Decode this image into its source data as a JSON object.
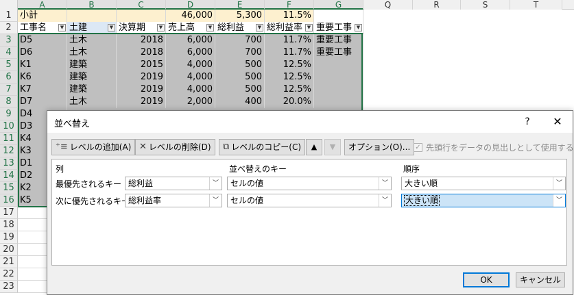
{
  "sheet": {
    "columns": [
      "A",
      "B",
      "C",
      "D",
      "E",
      "F",
      "G",
      "Q",
      "R",
      "S",
      "T"
    ],
    "rows": [
      "1",
      "2",
      "3",
      "4",
      "5",
      "6",
      "7",
      "8",
      "9",
      "10",
      "11",
      "12",
      "13",
      "14",
      "15",
      "16",
      "17",
      "18",
      "19",
      "20",
      "21",
      "22",
      "23"
    ],
    "row1": [
      "小計",
      "",
      "",
      "46,000",
      "5,300",
      "11.5%",
      ""
    ],
    "headers": [
      "工事名",
      "土建",
      "決算期",
      "売上高",
      "総利益",
      "総利益率",
      "重要工事"
    ],
    "data": [
      [
        "D5",
        "土木",
        "2018",
        "6,000",
        "700",
        "11.7%",
        "重要工事"
      ],
      [
        "D6",
        "土木",
        "2018",
        "6,000",
        "700",
        "11.7%",
        "重要工事"
      ],
      [
        "K1",
        "建築",
        "2015",
        "4,000",
        "500",
        "12.5%",
        ""
      ],
      [
        "K6",
        "建築",
        "2019",
        "4,000",
        "500",
        "12.5%",
        ""
      ],
      [
        "K7",
        "建築",
        "2019",
        "4,000",
        "500",
        "12.5%",
        ""
      ],
      [
        "D7",
        "土木",
        "2019",
        "2,000",
        "400",
        "20.0%",
        ""
      ]
    ],
    "partial_col_a": [
      "D4",
      "D3",
      "K4",
      "K3",
      "D1",
      "D2",
      "K2",
      "K5"
    ]
  },
  "dialog": {
    "title": "並べ替え",
    "help": "?",
    "close": "✕",
    "toolbar": {
      "add_label": "レベルの追加(A)",
      "delete_label": "レベルの削除(D)",
      "copy_label": "レベルのコピー(C)",
      "up": "▲",
      "down": "▼",
      "options_label": "オプション(O)...",
      "header_check_label": "先頭行をデータの見出しとして使用する(H)"
    },
    "grid": {
      "col_header": "列",
      "key_header": "並べ替えのキー",
      "order_header": "順序",
      "levels": [
        {
          "label": "最優先されるキー",
          "column": "総利益",
          "key": "セルの値",
          "order": "大きい順"
        },
        {
          "label": "次に優先されるキー",
          "column": "総利益率",
          "key": "セルの値",
          "order": "大きい順"
        }
      ]
    },
    "ok_label": "OK",
    "cancel_label": "キャンセル"
  },
  "colors": {
    "accent": "#217346",
    "focus": "#0078d7",
    "subtotal_fill": "#fdf0cf",
    "selection_fill": "#bfbfbf"
  }
}
